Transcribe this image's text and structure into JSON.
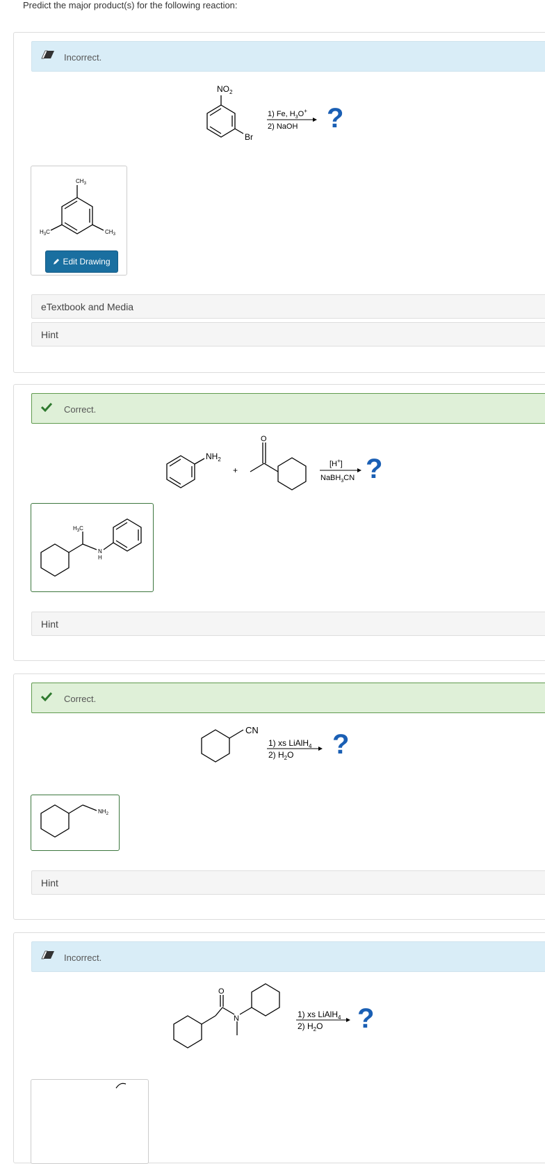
{
  "prompt": "Predict the major product(s) for the following reaction:",
  "colors": {
    "incorrect_bg": "#d9edf7",
    "correct_bg": "#dff0d8",
    "accent": "#1a6fa0",
    "question_mark": "#1a5fb4"
  },
  "questions": [
    {
      "status": "Incorrect.",
      "status_icon": "eraser-icon",
      "reactant_labels": {
        "no2": "NO",
        "no2_sub": "2",
        "br": "Br"
      },
      "conditions": {
        "line1": "1) Fe, H",
        "line1_sub": "3",
        "line1_tail": "O",
        "line1_sup": "+",
        "line2": "2) NaOH"
      },
      "question_mark": "?",
      "answer_labels": {
        "top": "CH",
        "top_sub": "3",
        "left": "H",
        "left_sub": "3",
        "left_tail": "C",
        "right": "CH",
        "right_sub": "3"
      },
      "edit_button": "Edit Drawing",
      "bars": [
        "eTextbook and Media",
        "Hint"
      ]
    },
    {
      "status": "Correct.",
      "status_icon": "checkmark-icon",
      "reactant_labels": {
        "nh2": "NH",
        "nh2_sub": "2",
        "plus": "+",
        "o": "O"
      },
      "conditions": {
        "line1": "[H",
        "line1_sup": "+",
        "line1_tail": "]",
        "line2": "NaBH",
        "line2_sub": "3",
        "line2_tail": "CN"
      },
      "question_mark": "?",
      "answer_labels": {
        "h3c": "H",
        "h3c_sub": "3",
        "h3c_tail": "C",
        "n": "N",
        "h": "H"
      },
      "bars": [
        "Hint"
      ]
    },
    {
      "status": "Correct.",
      "status_icon": "checkmark-icon",
      "reactant_labels": {
        "cn": "CN"
      },
      "conditions": {
        "line1": "1) xs LiAlH",
        "line1_sub": "4",
        "line2": "2) H",
        "line2_sub": "2",
        "line2_tail": "O"
      },
      "question_mark": "?",
      "answer_labels": {
        "nh2": "NH",
        "nh2_sub": "2"
      },
      "bars": [
        "Hint"
      ]
    },
    {
      "status": "Incorrect.",
      "status_icon": "eraser-icon",
      "reactant_labels": {
        "o": "O",
        "n": "N"
      },
      "conditions": {
        "line1": "1) xs LiAlH",
        "line1_sub": "4",
        "line2": "2) H",
        "line2_sub": "2",
        "line2_tail": "O"
      },
      "question_mark": "?"
    }
  ]
}
